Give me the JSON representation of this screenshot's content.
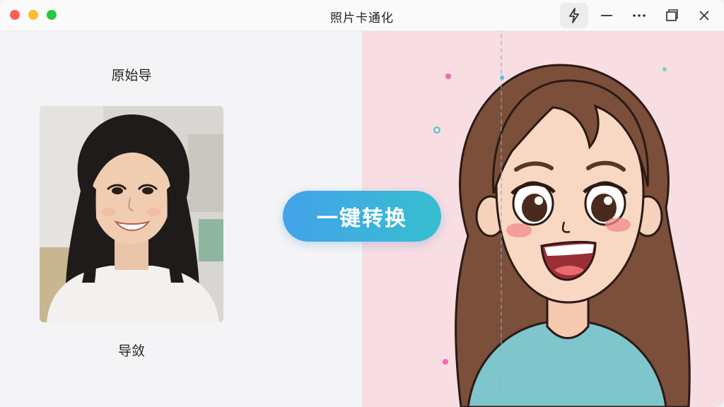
{
  "window": {
    "title": "照片卡通化"
  },
  "left": {
    "label_top": "原始导",
    "label_bottom": "导敛"
  },
  "actions": {
    "convert_label": "一键转换"
  },
  "colors": {
    "accent_start": "#44a2ea",
    "accent_end": "#36bfcf",
    "right_bg": "#f8dde3"
  },
  "icons": [
    "lightning-icon",
    "minimize-icon",
    "more-icon",
    "restore-icon",
    "close-icon"
  ]
}
